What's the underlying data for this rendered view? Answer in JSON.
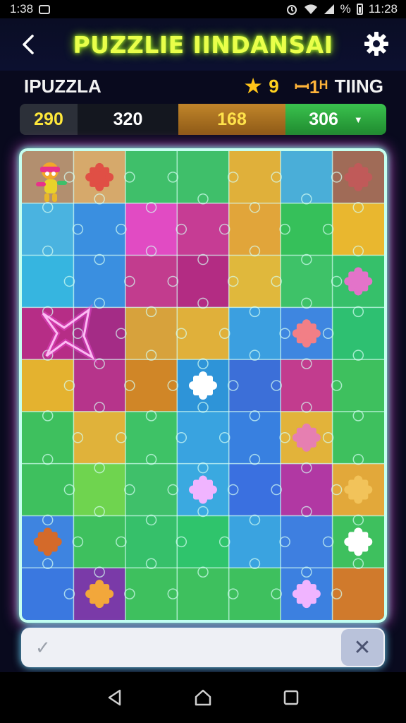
{
  "status_bar": {
    "time_left": "1:38",
    "time_right": "11:28",
    "notification_icon": "notification-icon",
    "right_icons": [
      "alarm-icon",
      "wifi-icon",
      "signal-icon",
      "battery-icon"
    ],
    "percent_sign": "%"
  },
  "header": {
    "title": "PUZZLIE IINDANSAI",
    "back_icon": "chevron-left-icon",
    "settings_icon": "gear-icon"
  },
  "subheader": {
    "label": "IPUZZLA",
    "star_icon": "star-icon",
    "star_value": "9",
    "level_text": "ꟷ1ᴴ",
    "status_text": "TIING"
  },
  "scores": {
    "a": "290",
    "b": "320",
    "c": "168",
    "d": "306",
    "dropdown_icon": "chevron-down-icon"
  },
  "board": {
    "columns": 7,
    "rows": 9,
    "tile_colors": [
      [
        "#b28f6f",
        "#d6a96b",
        "#3fbf6a",
        "#3fbf6a",
        "#e0b03a",
        "#4aaed8",
        "#a06b57"
      ],
      [
        "#4ab3e0",
        "#3a8fe0",
        "#e14bc3",
        "#c63c94",
        "#e1a53a",
        "#36c05a",
        "#e9b72f"
      ],
      [
        "#36b5e0",
        "#3a8fe0",
        "#c23c8e",
        "#b32c83",
        "#e0b83c",
        "#3ec268",
        "#36c06a"
      ],
      [
        "#b62d86",
        "#a42c86",
        "#d7a23c",
        "#e0b03a",
        "#3b9fe0",
        "#3e86e0",
        "#2ec071"
      ],
      [
        "#e4b22f",
        "#b6348b",
        "#d08627",
        "#2e94d8",
        "#3c6fd8",
        "#c23c8e",
        "#3ec05e"
      ],
      [
        "#3ec05e",
        "#e0b23a",
        "#3ec266",
        "#39a3e0",
        "#3880e0",
        "#e2b33a",
        "#3ec05e"
      ],
      [
        "#3ec05e",
        "#6fd44f",
        "#3fc06a",
        "#3aa9e0",
        "#3a70e0",
        "#b138a3",
        "#e2a83a"
      ],
      [
        "#3e84e0",
        "#3ec05e",
        "#36c06a",
        "#2fc46c",
        "#3aa3e0",
        "#3e7fe0",
        "#3ec05e"
      ],
      [
        "#3a78e0",
        "#7a3aa8",
        "#3ec05e",
        "#3ec05e",
        "#3ec05e",
        "#3c80e0",
        "#d07a2c"
      ]
    ],
    "loose_pieces": [
      {
        "col": 1,
        "row": 0,
        "color": "#e04f45"
      },
      {
        "col": 6,
        "row": 0,
        "color": "#c05a59"
      },
      {
        "col": 5,
        "row": 3,
        "color": "#f27f86"
      },
      {
        "col": 6,
        "row": 2,
        "color": "#e373c9"
      },
      {
        "col": 3,
        "row": 4,
        "color": "#ffffff"
      },
      {
        "col": 5,
        "row": 5,
        "color": "#e67fb1"
      },
      {
        "col": 3,
        "row": 6,
        "color": "#f0b4ff"
      },
      {
        "col": 6,
        "row": 6,
        "color": "#f2c35a"
      },
      {
        "col": 6,
        "row": 7,
        "color": "#ffffff"
      },
      {
        "col": 0,
        "row": 7,
        "color": "#d46a2a"
      },
      {
        "col": 1,
        "row": 8,
        "color": "#f2a73b"
      },
      {
        "col": 5,
        "row": 8,
        "color": "#f0b4ff"
      }
    ],
    "mascot_icon": "mascot-character-icon",
    "highlight_icon": "glowing-piece-outline-icon"
  },
  "answer_bar": {
    "confirm_icon": "check-icon",
    "value": "",
    "clear_icon": "close-icon"
  },
  "nav_bar": {
    "back_icon": "nav-back-triangle-icon",
    "home_icon": "nav-home-icon",
    "recents_icon": "nav-recents-square-icon"
  }
}
